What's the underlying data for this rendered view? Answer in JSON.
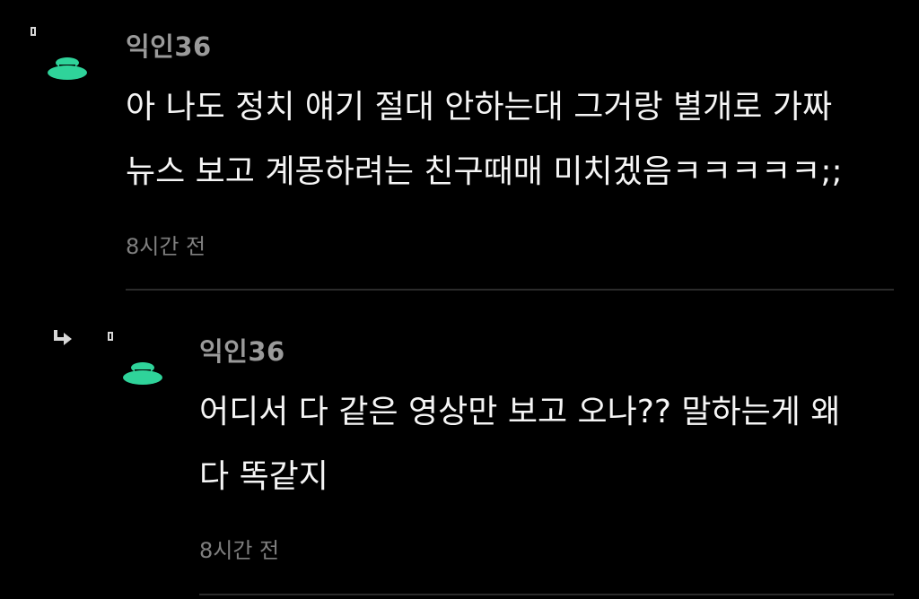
{
  "comments": [
    {
      "nickname": "익인36",
      "lines": [
        "아 나도 정치 얘기 절대 안하는대 그거랑 별개로 가짜",
        "뉴스 보고 계몽하려는 친구때매 미치겠음ㅋㅋㅋㅋㅋ;;"
      ],
      "time": "8시간 전",
      "is_reply": false,
      "avatar_icon": "mushroom-avatar-icon"
    },
    {
      "nickname": "익인36",
      "lines": [
        "어디서 다 같은 영상만 보고 오나?? 말하는게 왜",
        "다 똑같지"
      ],
      "time": "8시간 전",
      "is_reply": true,
      "avatar_icon": "mushroom-avatar-icon",
      "reply_icon": "reply-arrow-icon"
    }
  ],
  "colors": {
    "background": "#000000",
    "avatar": "#2fd39a",
    "nickname": "#9a9a9a",
    "text": "#f5f5f5",
    "time": "#7f7f7f",
    "divider": "#2b2b2b"
  }
}
